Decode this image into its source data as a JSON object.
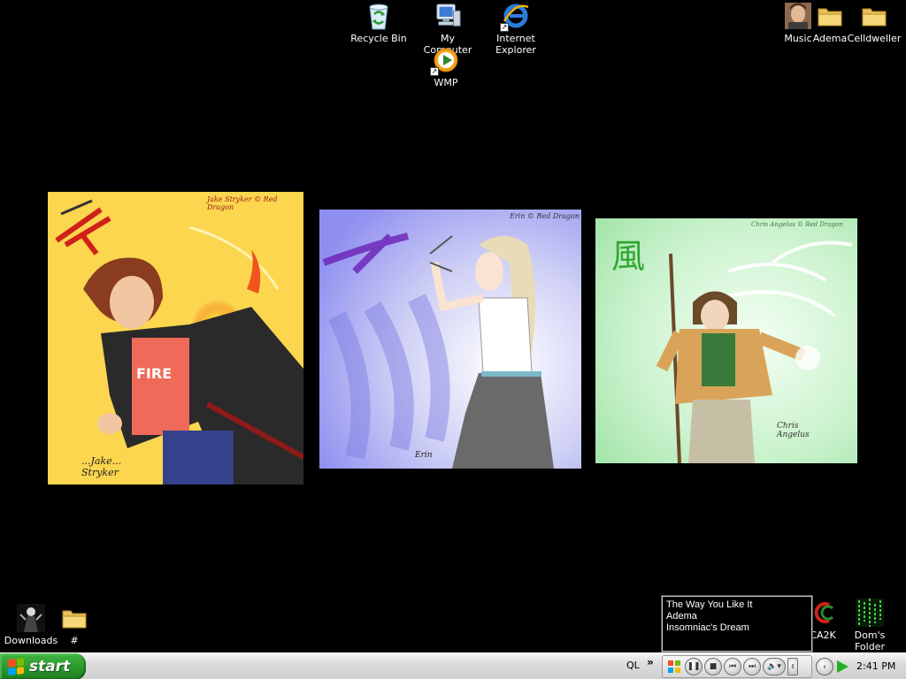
{
  "desktop": {
    "top_icons": [
      {
        "name": "recycle-bin-icon",
        "label": "Recycle Bin"
      },
      {
        "name": "my-computer-icon",
        "label": "My Computer"
      },
      {
        "name": "internet-explorer-icon",
        "label": "Internet\nExplorer"
      },
      {
        "name": "wmp-icon",
        "label": "WMP"
      }
    ],
    "top_right_icons": [
      {
        "name": "music-icon",
        "label": "Music"
      },
      {
        "name": "adema-folder-icon",
        "label": "Adema"
      },
      {
        "name": "celldweller-folder-icon",
        "label": "Celldweller"
      }
    ],
    "bottom_left_icons": [
      {
        "name": "downloads-icon",
        "label": "Downloads"
      },
      {
        "name": "hash-folder-icon",
        "label": "#"
      }
    ],
    "bottom_right_icons": [
      {
        "name": "ca2k-icon",
        "label": "CA2K"
      },
      {
        "name": "doms-folder-icon",
        "label": "Dom's Folder"
      }
    ],
    "artworks": [
      {
        "credit": "Jake Stryker © Red Dragon",
        "signature": "...Jake... Stryker",
        "shirt": "FIRE",
        "glyph": "炎"
      },
      {
        "credit": "Erin © Red Dragon",
        "signature": "Erin"
      },
      {
        "credit": "Chris Angelus © Red Dragon",
        "signature": "Chris Angelus",
        "glyph": "風"
      }
    ]
  },
  "now_playing": {
    "title": "The Way You Like It",
    "artist": "Adema",
    "album": "Insomniac's Dream"
  },
  "taskbar": {
    "start_label": "start",
    "quick_launch_label": "QL",
    "chevron": "»",
    "clock": "2:41 PM"
  },
  "colors": {
    "start_green": "#2f9a2f",
    "desktop": "#000000",
    "taskbar": "#d6d6d6"
  }
}
